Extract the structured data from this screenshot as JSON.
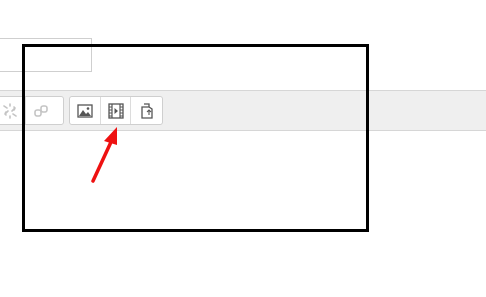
{
  "top_field": {
    "value": ""
  },
  "toolbar": {
    "group_left": [
      {
        "icon": "unlink-icon",
        "enabled": false
      },
      {
        "icon": "anchor-icon",
        "enabled": false
      }
    ],
    "group_media": [
      {
        "icon": "image-icon",
        "label": ""
      },
      {
        "icon": "video-icon",
        "label": ""
      },
      {
        "icon": "manage-files-icon",
        "label": ""
      }
    ]
  },
  "annotation": {
    "highlight_color": "#000000",
    "arrow_color": "#ee1111"
  }
}
